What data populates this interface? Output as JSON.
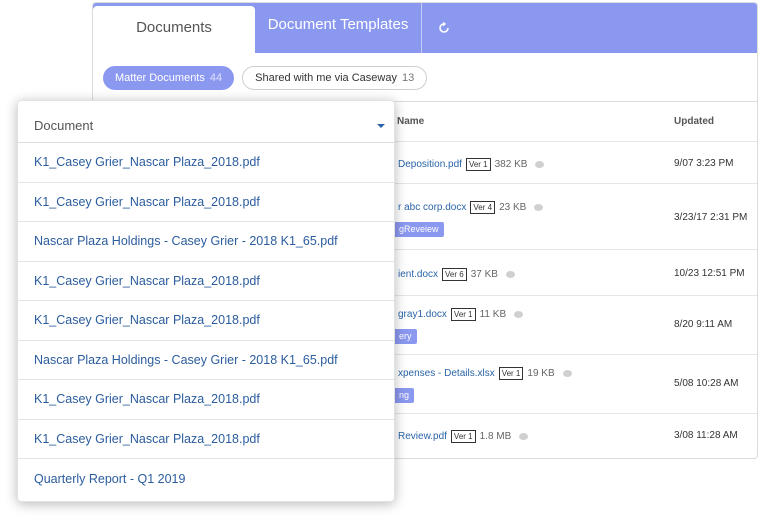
{
  "tabs": [
    {
      "label": "Documents"
    },
    {
      "label": "Document Templates"
    }
  ],
  "filters": [
    {
      "label": "Matter Documents",
      "count": "44"
    },
    {
      "label": "Shared with me via Caseway",
      "count": "13"
    }
  ],
  "table": {
    "headers": {
      "name": "Name",
      "updated": "Updated"
    },
    "rows": [
      {
        "name": "Deposition.pdf",
        "ver": "Ver 1",
        "size": "382 KB",
        "tag": "",
        "updated": "9/07 3:23 PM"
      },
      {
        "name": "r abc corp.docx",
        "ver": "Ver 4",
        "size": "23 KB",
        "tag": "gReveiew",
        "updated": "3/23/17 2:31 PM"
      },
      {
        "name": "ient.docx",
        "ver": "Ver 6",
        "size": "37 KB",
        "tag": "",
        "updated": "10/23 12:51 PM"
      },
      {
        "name": "gray1.docx",
        "ver": "Ver 1",
        "size": "11 KB",
        "tag": "ery",
        "updated": "8/20 9:11 AM"
      },
      {
        "name": "xpenses - Details.xlsx",
        "ver": "Ver 1",
        "size": "19 KB",
        "tag": "ng",
        "updated": "5/08 10:28 AM"
      },
      {
        "name": "Review.pdf",
        "ver": "Ver 1",
        "size": "1.8 MB",
        "tag": "",
        "updated": "3/08 11:28 AM"
      }
    ]
  },
  "dropdown": {
    "title": "Document",
    "items": [
      "K1_Casey Grier_Nascar Plaza_2018.pdf",
      "K1_Casey Grier_Nascar Plaza_2018.pdf",
      "Nascar Plaza Holdings - Casey Grier - 2018 K1_65.pdf",
      "K1_Casey Grier_Nascar Plaza_2018.pdf",
      "K1_Casey Grier_Nascar Plaza_2018.pdf",
      "Nascar Plaza Holdings - Casey Grier - 2018 K1_65.pdf",
      "K1_Casey Grier_Nascar Plaza_2018.pdf",
      "K1_Casey Grier_Nascar Plaza_2018.pdf",
      "Quarterly Report - Q1 2019"
    ]
  },
  "icons": {
    "refresh": "refresh-icon",
    "caret": "caret-down-icon",
    "comment": "comment-icon"
  },
  "colors": {
    "accent": "#8b98f0",
    "link": "#2a64a8"
  }
}
